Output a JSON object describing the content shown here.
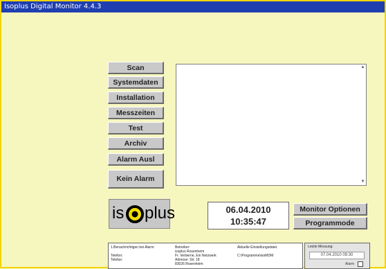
{
  "window": {
    "title": "Isoplus Digital Monitor 4.4.3"
  },
  "menu_buttons": [
    {
      "key": "scan",
      "label": "Scan"
    },
    {
      "key": "systemdaten",
      "label": "Systemdaten"
    },
    {
      "key": "installation",
      "label": "Installation"
    },
    {
      "key": "messzeiten",
      "label": "Messzeiten"
    },
    {
      "key": "test",
      "label": "Test"
    },
    {
      "key": "archiv",
      "label": "Archiv"
    },
    {
      "key": "alarm-ausl",
      "label": "Alarm Ausl"
    },
    {
      "key": "kein-alarm",
      "label": "Kein Alarm"
    }
  ],
  "logo": {
    "left_text": "is",
    "right_text": "plus"
  },
  "datetime": {
    "date": "06.04.2010",
    "time": "10:35:47"
  },
  "right_buttons": {
    "monitor_options": "Monitor Optionen",
    "programmode": "Programmode"
  },
  "info_panel": {
    "col1": [
      "1.Benachrichtigen bei Alarm:",
      "",
      "Telefon:",
      "Telefax:"
    ],
    "col2": [
      "Betreiber:",
      "isoplus Rosenheim",
      "Fr. Verberne, Ein Netzwerk",
      "Adresse: Str. 18",
      "83026 Rosenheim"
    ],
    "col3": [
      "Aktuelle Einstellungsdatei:",
      "",
      "C:\\Programme\\isoMDM"
    ]
  },
  "last_measure": {
    "label": "Letzte Messung:",
    "value": "07.04.2010 09:30",
    "alarm_label": "Alarm"
  }
}
